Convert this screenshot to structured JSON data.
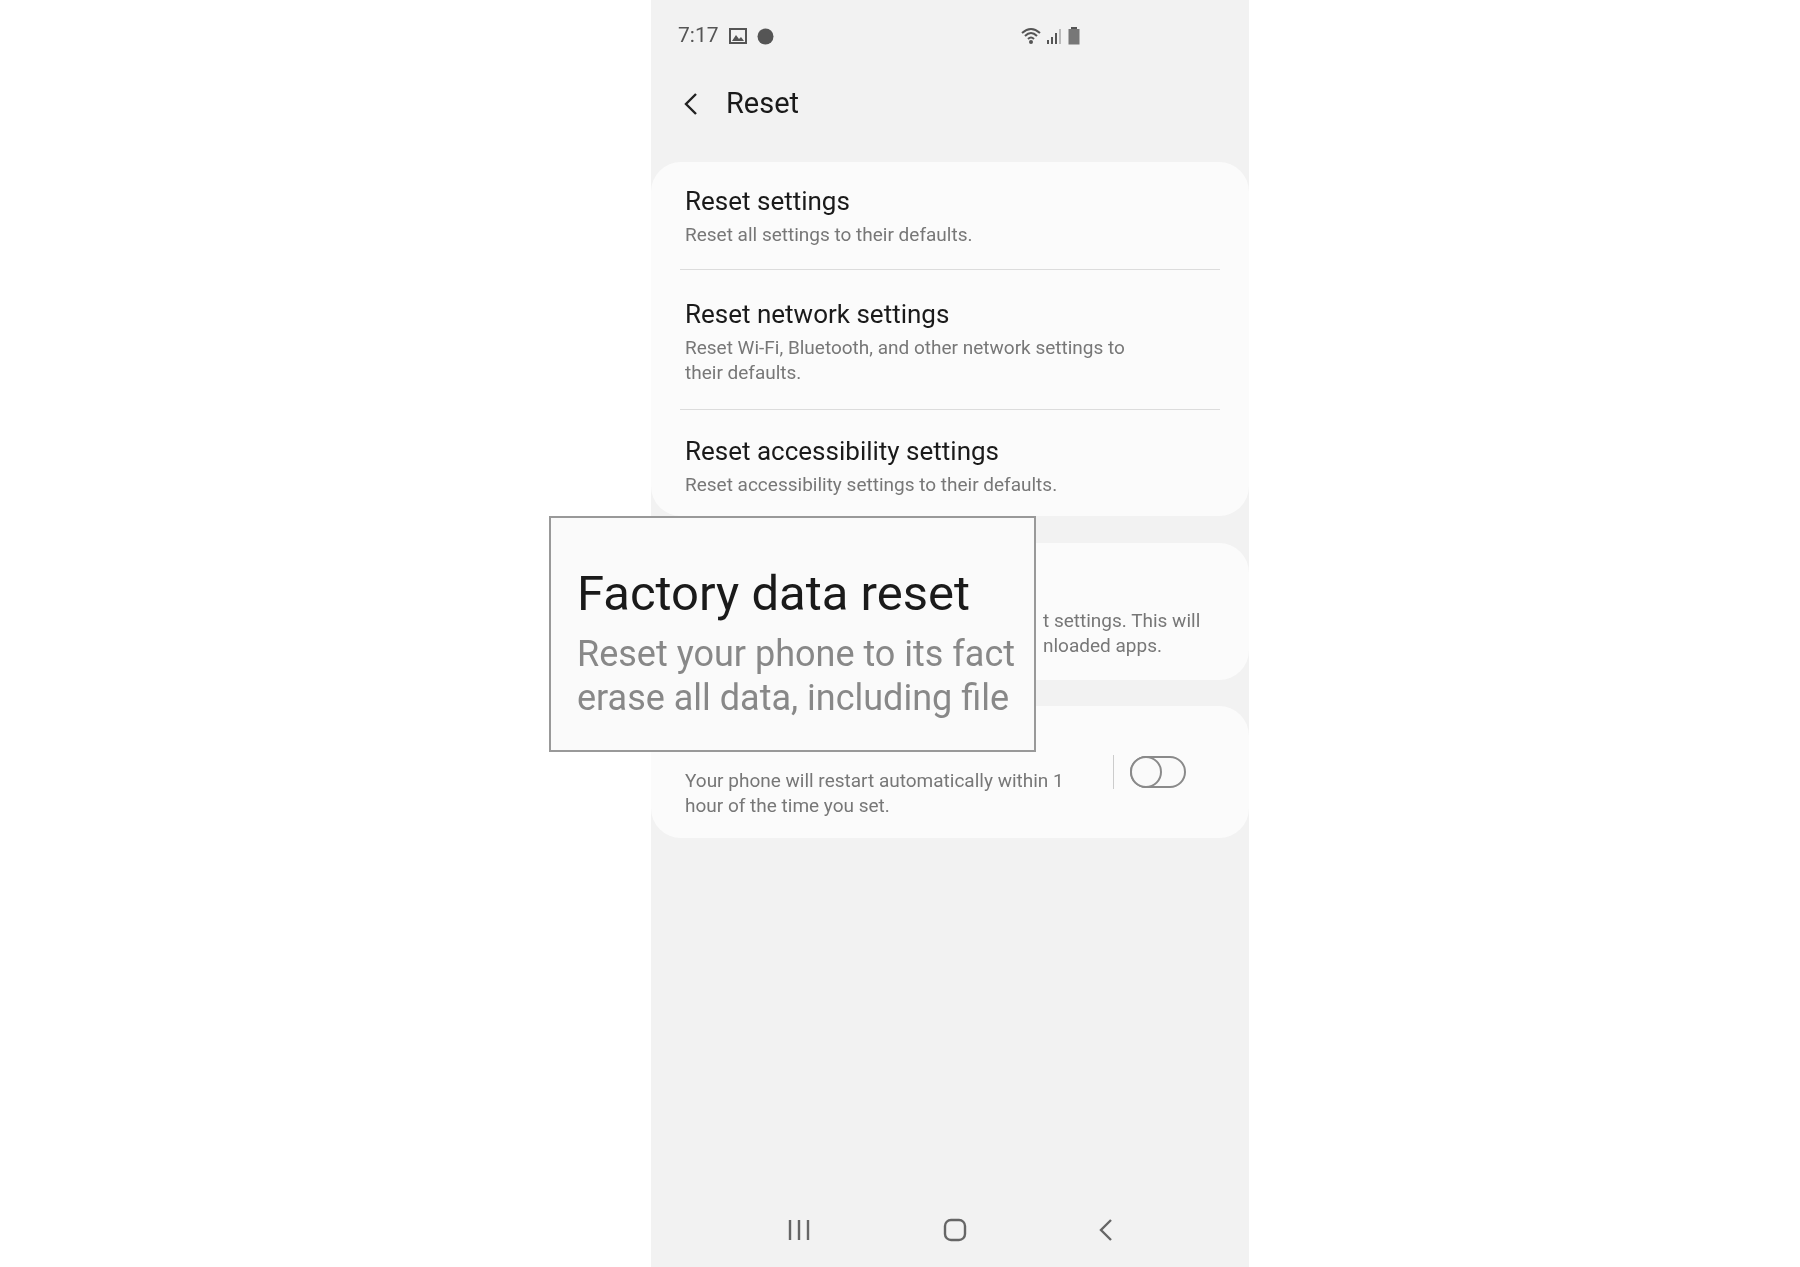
{
  "status_bar": {
    "time": "7:17"
  },
  "header": {
    "title": "Reset"
  },
  "settings_card": {
    "items": [
      {
        "title": "Reset settings",
        "description": "Reset all settings to their defaults."
      },
      {
        "title": "Reset network settings",
        "description": "Reset Wi-Fi, Bluetooth, and other network settings to their defaults."
      },
      {
        "title": "Reset accessibility settings",
        "description": "Reset accessibility settings to their defaults."
      }
    ]
  },
  "factory_card": {
    "description_lines": [
      "t settings. This will",
      "nloaded apps."
    ]
  },
  "auto_restart_card": {
    "description": "Your phone will restart automatically within 1 hour of the time you set.",
    "toggle": {
      "on": false
    }
  },
  "callout": {
    "title": "Factory data reset",
    "lines": [
      "Reset your phone to its fact",
      "erase all data, including file"
    ]
  }
}
